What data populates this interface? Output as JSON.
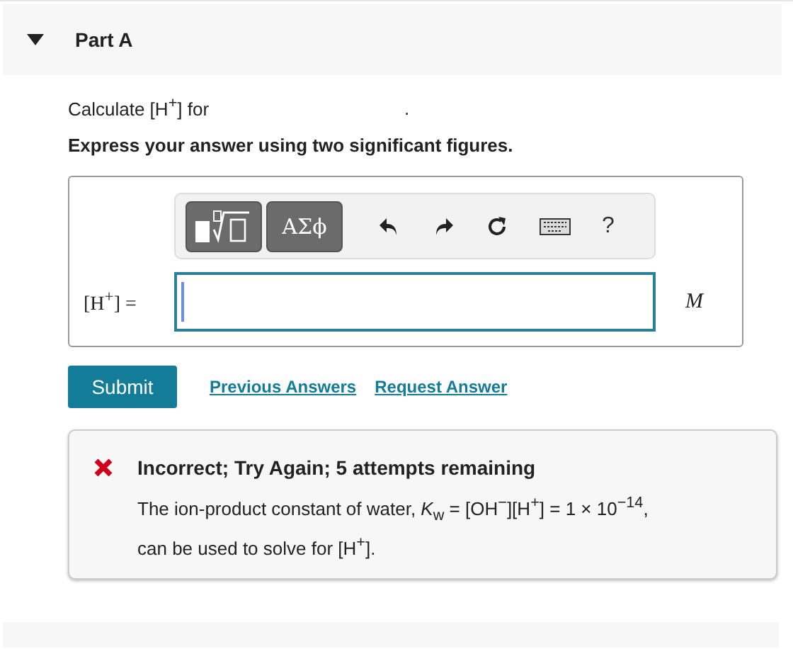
{
  "part": {
    "title": "Part A",
    "expanded": true
  },
  "prompt": {
    "text": "Calculate [H$^{+}$] for",
    "period": "."
  },
  "instruction": "Express your answer using two significant figures.",
  "toolbar": {
    "symbols_label": "ΑΣϕ",
    "help_label": "?"
  },
  "answer": {
    "label": "[H$^{+}$] =",
    "unit": "M"
  },
  "actions": {
    "submit": "Submit",
    "links": [
      "Previous Answers",
      "Request Answer"
    ]
  },
  "feedback": {
    "correct": false,
    "title": "Incorrect; Try Again; 5 attempts remaining",
    "text": "The ion-product constant of water, *K*$_{w}$ = [OH$^{−}$][H$^{+}$] = 1 × 10$^{−14}$, can be used to solve for [H$^{+}$]."
  }
}
